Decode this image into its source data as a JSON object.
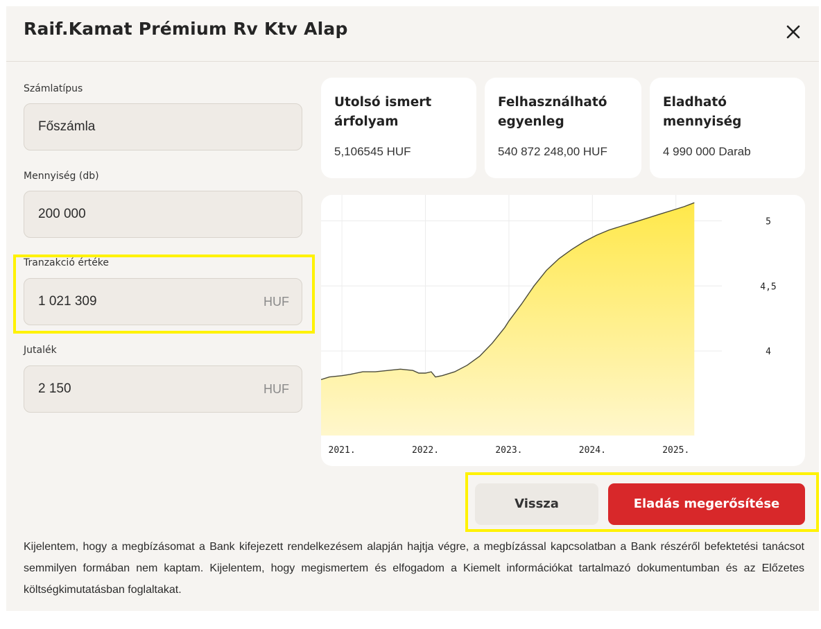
{
  "header": {
    "title": "Raif.Kamat Prémium Rv Ktv Alap",
    "close_icon": "close-icon"
  },
  "form": {
    "account_type": {
      "label": "Számlatípus",
      "value": "Főszámla"
    },
    "quantity": {
      "label": "Mennyiség (db)",
      "value": "200 000"
    },
    "transaction_value": {
      "label": "Tranzakció értéke",
      "value": "1 021 309",
      "unit": "HUF"
    },
    "commission": {
      "label": "Jutalék",
      "value": "2 150",
      "unit": "HUF"
    }
  },
  "cards": [
    {
      "title": "Utolsó ismert árfolyam",
      "value": "5,106545 HUF"
    },
    {
      "title": "Felhasználható egyenleg",
      "value": "540 872 248,00 HUF"
    },
    {
      "title": "Eladható mennyiség",
      "value": "4 990 000 Darab"
    }
  ],
  "chart_data": {
    "type": "area",
    "x_ticks": [
      "2021.",
      "2022.",
      "2023.",
      "2024.",
      "2025."
    ],
    "y_ticks": [
      "5",
      "4,5",
      "4"
    ],
    "xlim": [
      2020.75,
      2025.55
    ],
    "ylim": [
      3.35,
      5.2
    ],
    "grid": true,
    "series": [
      {
        "points": [
          [
            2020.75,
            3.78
          ],
          [
            2020.85,
            3.8
          ],
          [
            2021.0,
            3.81
          ],
          [
            2021.1,
            3.82
          ],
          [
            2021.25,
            3.84
          ],
          [
            2021.4,
            3.84
          ],
          [
            2021.55,
            3.85
          ],
          [
            2021.7,
            3.86
          ],
          [
            2021.85,
            3.85
          ],
          [
            2021.92,
            3.83
          ],
          [
            2022.0,
            3.83
          ],
          [
            2022.07,
            3.84
          ],
          [
            2022.12,
            3.8
          ],
          [
            2022.2,
            3.81
          ],
          [
            2022.35,
            3.84
          ],
          [
            2022.5,
            3.89
          ],
          [
            2022.65,
            3.96
          ],
          [
            2022.8,
            4.06
          ],
          [
            2022.95,
            4.18
          ],
          [
            2023.0,
            4.23
          ],
          [
            2023.15,
            4.36
          ],
          [
            2023.3,
            4.5
          ],
          [
            2023.45,
            4.62
          ],
          [
            2023.6,
            4.71
          ],
          [
            2023.75,
            4.78
          ],
          [
            2023.9,
            4.84
          ],
          [
            2024.05,
            4.89
          ],
          [
            2024.2,
            4.93
          ],
          [
            2024.35,
            4.96
          ],
          [
            2024.5,
            4.99
          ],
          [
            2024.65,
            5.02
          ],
          [
            2024.8,
            5.05
          ],
          [
            2024.95,
            5.08
          ],
          [
            2025.1,
            5.11
          ],
          [
            2025.22,
            5.14
          ]
        ]
      }
    ],
    "colors": {
      "fill_top": "#ffe84a",
      "fill_bottom": "#fff7cc",
      "line": "#4a4a3a"
    }
  },
  "buttons": {
    "back": "Vissza",
    "confirm": "Eladás megerősítése"
  },
  "disclaimer": "Kijelentem, hogy a megbízásomat a Bank kifejezett rendelkezésem alapján hajtja végre, a megbízással kapcsolatban a Bank részéről befektetési tanácsot semmilyen formában nem kaptam. Kijelentem, hogy megismertem és elfogadom a Kiemelt információkat tartalmazó dokumentumban és az Előzetes költségkimutatásban foglaltakat."
}
